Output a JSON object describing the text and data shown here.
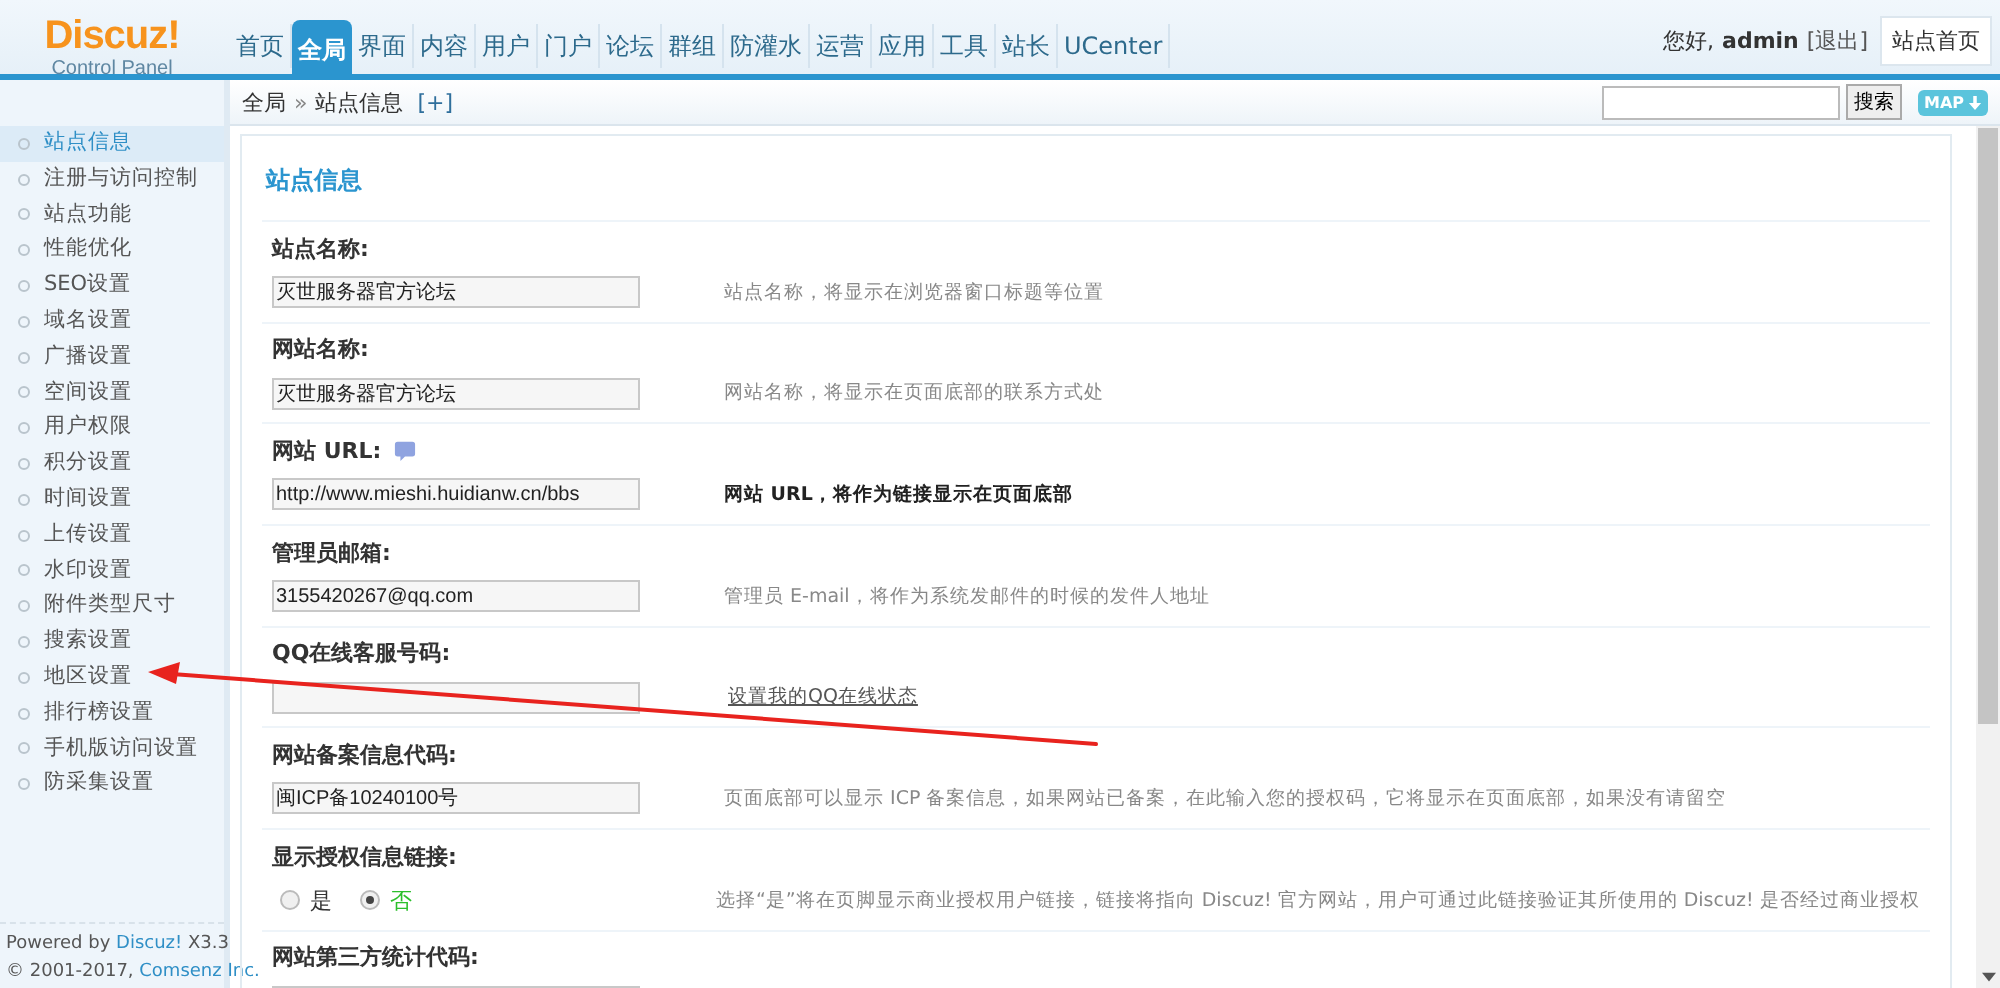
{
  "logo": {
    "title": "Discuz!",
    "subtitle": "Control Panel"
  },
  "nav": [
    {
      "label": "首页",
      "selected": false
    },
    {
      "label": "全局",
      "selected": true
    },
    {
      "label": "界面",
      "selected": false
    },
    {
      "label": "内容",
      "selected": false
    },
    {
      "label": "用户",
      "selected": false
    },
    {
      "label": "门户",
      "selected": false
    },
    {
      "label": "论坛",
      "selected": false
    },
    {
      "label": "群组",
      "selected": false
    },
    {
      "label": "防灌水",
      "selected": false
    },
    {
      "label": "运营",
      "selected": false
    },
    {
      "label": "应用",
      "selected": false
    },
    {
      "label": "工具",
      "selected": false
    },
    {
      "label": "站长",
      "selected": false
    },
    {
      "label": "UCenter",
      "selected": false
    }
  ],
  "user": {
    "greeting": "您好,",
    "name": "admin",
    "logout": "[退出]",
    "home_button": "站点首页"
  },
  "breadcrumb": {
    "root": "全局",
    "separator": "»",
    "current": "站点信息",
    "add": "[+]"
  },
  "search": {
    "button": "搜索",
    "map_button": "MAP"
  },
  "sidebar": {
    "items": [
      {
        "label": "站点信息",
        "selected": true
      },
      {
        "label": "注册与访问控制",
        "selected": false
      },
      {
        "label": "站点功能",
        "selected": false
      },
      {
        "label": "性能优化",
        "selected": false
      },
      {
        "label": "SEO设置",
        "selected": false
      },
      {
        "label": "域名设置",
        "selected": false
      },
      {
        "label": "广播设置",
        "selected": false
      },
      {
        "label": "空间设置",
        "selected": false
      },
      {
        "label": "用户权限",
        "selected": false
      },
      {
        "label": "积分设置",
        "selected": false
      },
      {
        "label": "时间设置",
        "selected": false
      },
      {
        "label": "上传设置",
        "selected": false
      },
      {
        "label": "水印设置",
        "selected": false
      },
      {
        "label": "附件类型尺寸",
        "selected": false
      },
      {
        "label": "搜索设置",
        "selected": false
      },
      {
        "label": "地区设置",
        "selected": false
      },
      {
        "label": "排行榜设置",
        "selected": false
      },
      {
        "label": "手机版访问设置",
        "selected": false
      },
      {
        "label": "防采集设置",
        "selected": false
      }
    ],
    "footer": [
      [
        {
          "text": "Powered by ",
          "link": false
        },
        {
          "text": "Discuz!",
          "link": true
        },
        {
          "text": " X3.3",
          "link": false
        }
      ],
      [
        {
          "text": "© 2001-2017, ",
          "link": false
        },
        {
          "text": "Comsenz Inc.",
          "link": true
        }
      ]
    ]
  },
  "main": {
    "title": "站点信息",
    "rows": [
      {
        "kind": "text",
        "label": "站点名称:",
        "value": "灭世服务器官方论坛",
        "hint": "站点名称，将显示在浏览器窗口标题等位置"
      },
      {
        "kind": "text",
        "label": "网站名称:",
        "value": "灭世服务器官方论坛",
        "hint": "网站名称，将显示在页面底部的联系方式处"
      },
      {
        "kind": "text",
        "label": "网站 URL:",
        "help": true,
        "value": "http://www.mieshi.huidianw.cn/bbs",
        "hint": "网站 URL，将作为链接显示在页面底部",
        "hint_emphasis": true
      },
      {
        "kind": "text",
        "label": "管理员邮箱:",
        "value": "3155420267@qq.com",
        "hint": "管理员 E-mail，将作为系统发邮件的时候的发件人地址"
      },
      {
        "kind": "text",
        "label": "QQ在线客服号码:",
        "link": "设置我的QQ在线状态"
      },
      {
        "kind": "text",
        "label": "网站备案信息代码:",
        "value": "闽ICP备10240100号",
        "hint": "页面底部可以显示 ICP 备案信息，如果网站已备案，在此输入您的授权码，它将显示在页面底部，如果没有请留空"
      },
      {
        "kind": "radio",
        "label": "显示授权信息链接:",
        "options": [
          {
            "label": "是",
            "selected": false
          },
          {
            "label": "否",
            "selected": true
          }
        ],
        "hint": "选择“是”将在页脚显示商业授权用户链接，链接将指向 Discuz! 官方网站，用户可通过此链接验证其所使用的 Discuz! 是否经过商业授权"
      },
      {
        "kind": "text",
        "label": "网站第三方统计代码:"
      }
    ]
  }
}
